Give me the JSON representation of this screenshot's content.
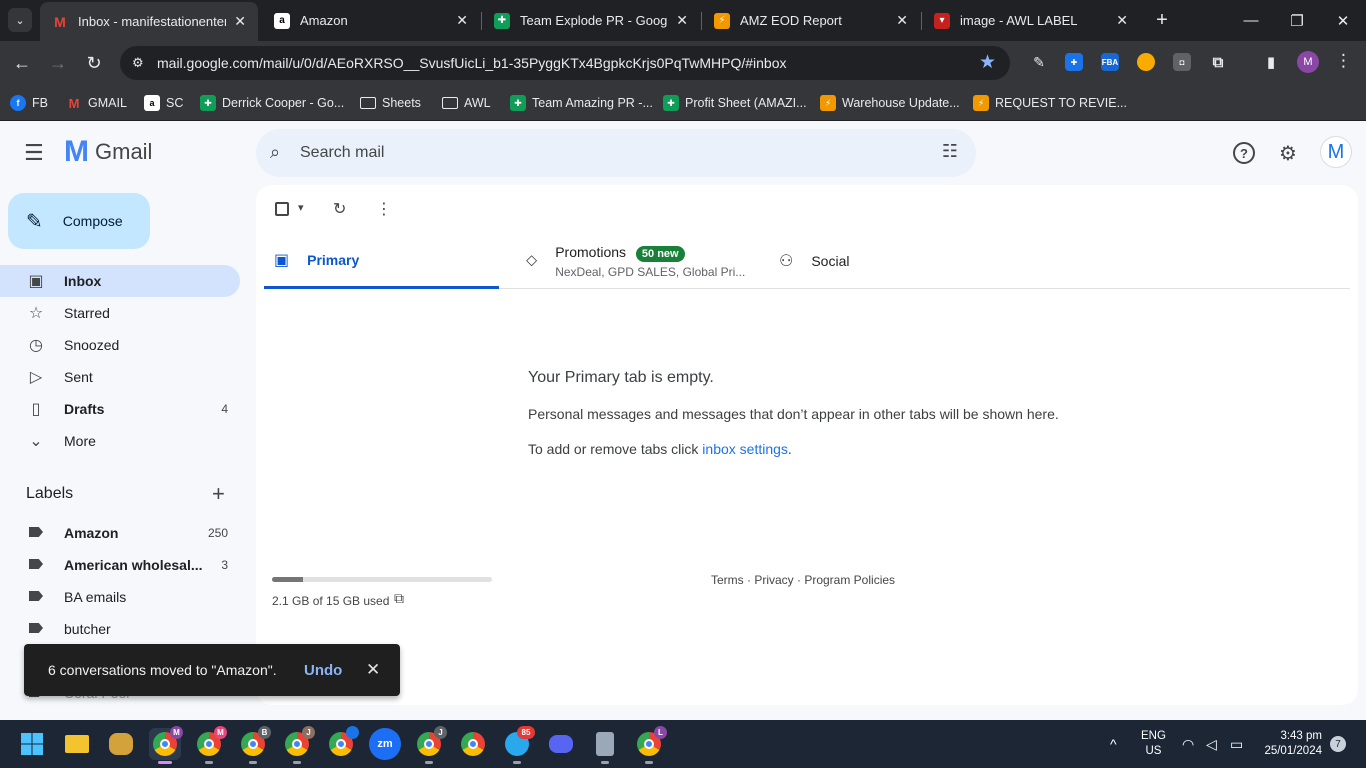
{
  "browser": {
    "tabs": [
      {
        "title": "Inbox - manifestationenterp",
        "active": true
      },
      {
        "title": "Amazon"
      },
      {
        "title": "Team Explode PR - Google S"
      },
      {
        "title": "AMZ EOD Report"
      },
      {
        "title": "image - AWL LABEL"
      }
    ],
    "url": "mail.google.com/mail/u/0/d/AEoRXRSO__SvusfUicLi_b1-35PyggKTx4BgpkcKrjs0PqTwMHPQ/#inbox",
    "profile_initial": "M",
    "bookmarks": [
      "FB",
      "GMAIL",
      "SC",
      "Derrick Cooper - Go...",
      "Sheets",
      "AWL",
      "Team Amazing PR -...",
      "Profit Sheet (AMAZI...",
      "Warehouse Update...",
      "REQUEST TO REVIE..."
    ],
    "ext_fba": "FBA"
  },
  "gmail": {
    "logo_text": "Gmail",
    "search_placeholder": "Search mail",
    "avatar_initial": "M",
    "compose_label": "Compose",
    "nav": [
      {
        "label": "Inbox",
        "count": ""
      },
      {
        "label": "Starred",
        "count": ""
      },
      {
        "label": "Snoozed",
        "count": ""
      },
      {
        "label": "Sent",
        "count": ""
      },
      {
        "label": "Drafts",
        "count": "4"
      },
      {
        "label": "More",
        "count": ""
      }
    ],
    "labels_heading": "Labels",
    "labels": [
      {
        "label": "Amazon",
        "count": "250"
      },
      {
        "label": "American wholesal...",
        "count": "3"
      },
      {
        "label": "BA emails",
        "count": ""
      },
      {
        "label": "butcher",
        "count": ""
      },
      {
        "label": "Coral Pool",
        "count": ""
      }
    ],
    "category_tabs": {
      "primary": "Primary",
      "promotions": "Promotions",
      "promotions_badge": "50 new",
      "promotions_sub": "NexDeal, GPD SALES, Global Pri...",
      "social": "Social"
    },
    "empty_title": "Your Primary tab is empty.",
    "empty_line1": "Personal messages and messages that don’t appear in other tabs will be shown here.",
    "empty_line2_prefix": "To add or remove tabs click ",
    "empty_link": "inbox settings",
    "empty_line2_suffix": ".",
    "storage_text": "2.1 GB of 15 GB used",
    "storage_fraction": 0.14,
    "footer": "Terms · Privacy · Program Policies",
    "toast_message": "6 conversations moved to \"Amazon\".",
    "toast_action": "Undo"
  },
  "taskbar": {
    "lang1": "ENG",
    "lang2": "US",
    "time": "3:43 pm",
    "date": "25/01/2024",
    "notification_count": "7",
    "badges": [
      "M",
      "B",
      "J",
      "J",
      "L"
    ],
    "telegram_badge": "85",
    "zoom_label": "zm"
  }
}
